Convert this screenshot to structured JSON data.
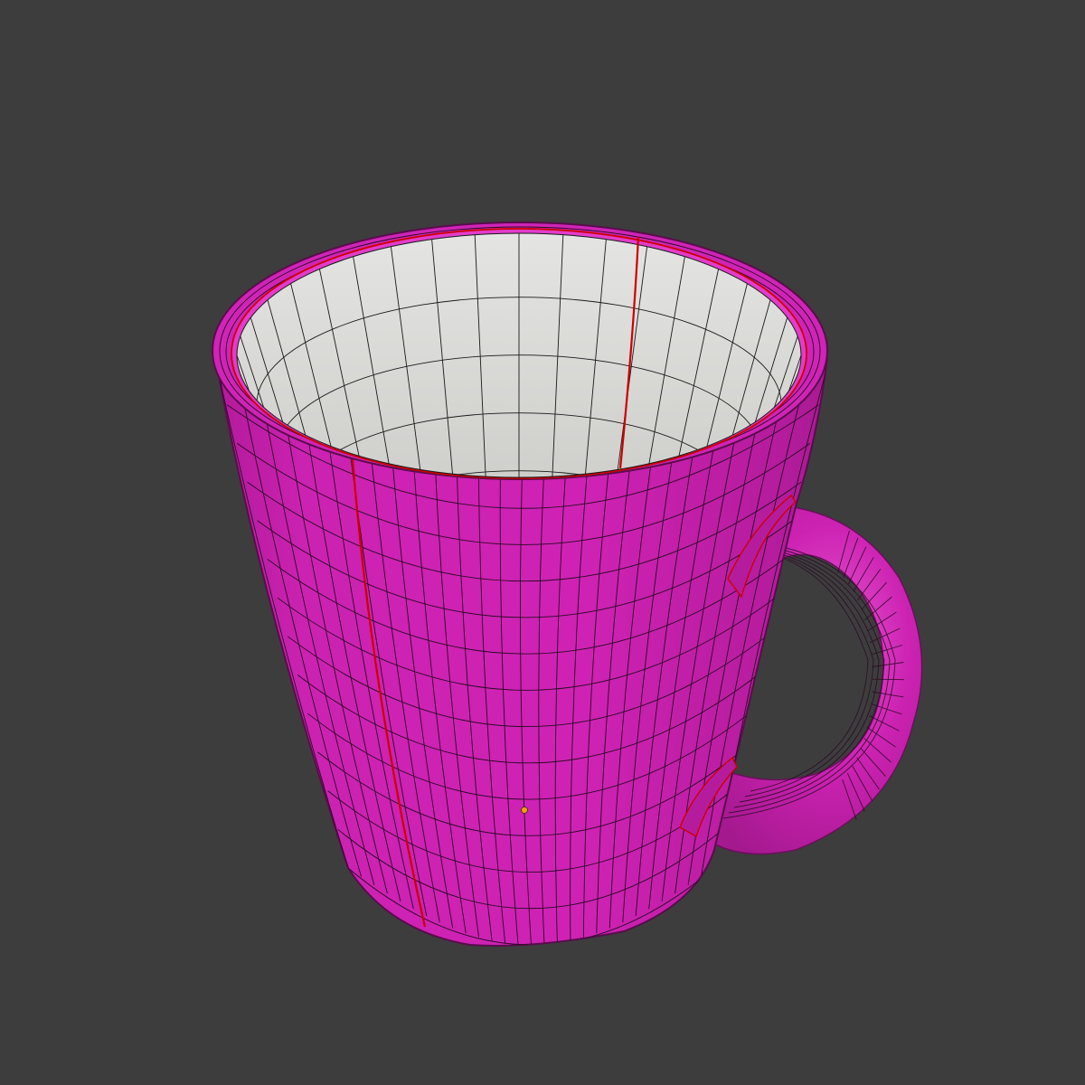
{
  "viewport": {
    "background_color": "#3d3d3d",
    "mode": "edit-mode-3d-viewport"
  },
  "model": {
    "object": "mug",
    "face_color": "#cc1fb0",
    "face_color_highlight": "#e236c8",
    "inner_color": "#d9d9d6",
    "wire_color": "#1a1a1a",
    "seam_color": "#d00000",
    "origin_color": "#f2a000"
  }
}
